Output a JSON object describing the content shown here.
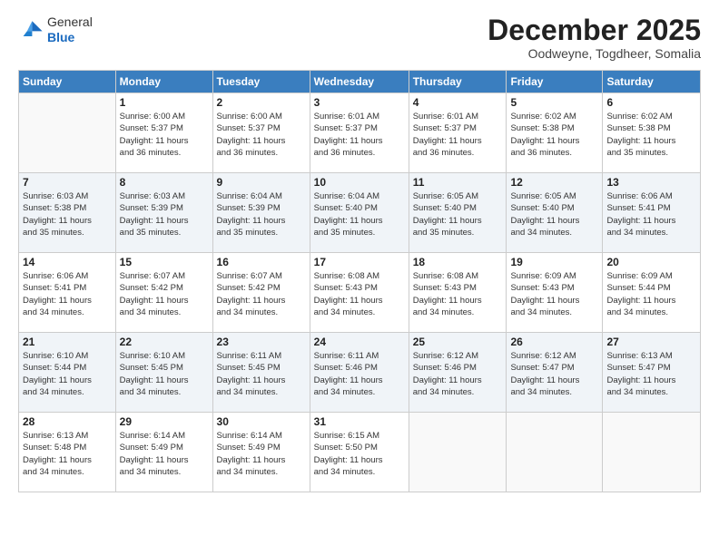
{
  "header": {
    "logo_line1": "General",
    "logo_line2": "Blue",
    "month": "December 2025",
    "location": "Oodweyne, Togdheer, Somalia"
  },
  "days_of_week": [
    "Sunday",
    "Monday",
    "Tuesday",
    "Wednesday",
    "Thursday",
    "Friday",
    "Saturday"
  ],
  "weeks": [
    [
      {
        "day": "",
        "info": ""
      },
      {
        "day": "1",
        "info": "Sunrise: 6:00 AM\nSunset: 5:37 PM\nDaylight: 11 hours\nand 36 minutes."
      },
      {
        "day": "2",
        "info": "Sunrise: 6:00 AM\nSunset: 5:37 PM\nDaylight: 11 hours\nand 36 minutes."
      },
      {
        "day": "3",
        "info": "Sunrise: 6:01 AM\nSunset: 5:37 PM\nDaylight: 11 hours\nand 36 minutes."
      },
      {
        "day": "4",
        "info": "Sunrise: 6:01 AM\nSunset: 5:37 PM\nDaylight: 11 hours\nand 36 minutes."
      },
      {
        "day": "5",
        "info": "Sunrise: 6:02 AM\nSunset: 5:38 PM\nDaylight: 11 hours\nand 36 minutes."
      },
      {
        "day": "6",
        "info": "Sunrise: 6:02 AM\nSunset: 5:38 PM\nDaylight: 11 hours\nand 35 minutes."
      }
    ],
    [
      {
        "day": "7",
        "info": "Sunrise: 6:03 AM\nSunset: 5:38 PM\nDaylight: 11 hours\nand 35 minutes."
      },
      {
        "day": "8",
        "info": "Sunrise: 6:03 AM\nSunset: 5:39 PM\nDaylight: 11 hours\nand 35 minutes."
      },
      {
        "day": "9",
        "info": "Sunrise: 6:04 AM\nSunset: 5:39 PM\nDaylight: 11 hours\nand 35 minutes."
      },
      {
        "day": "10",
        "info": "Sunrise: 6:04 AM\nSunset: 5:40 PM\nDaylight: 11 hours\nand 35 minutes."
      },
      {
        "day": "11",
        "info": "Sunrise: 6:05 AM\nSunset: 5:40 PM\nDaylight: 11 hours\nand 35 minutes."
      },
      {
        "day": "12",
        "info": "Sunrise: 6:05 AM\nSunset: 5:40 PM\nDaylight: 11 hours\nand 34 minutes."
      },
      {
        "day": "13",
        "info": "Sunrise: 6:06 AM\nSunset: 5:41 PM\nDaylight: 11 hours\nand 34 minutes."
      }
    ],
    [
      {
        "day": "14",
        "info": "Sunrise: 6:06 AM\nSunset: 5:41 PM\nDaylight: 11 hours\nand 34 minutes."
      },
      {
        "day": "15",
        "info": "Sunrise: 6:07 AM\nSunset: 5:42 PM\nDaylight: 11 hours\nand 34 minutes."
      },
      {
        "day": "16",
        "info": "Sunrise: 6:07 AM\nSunset: 5:42 PM\nDaylight: 11 hours\nand 34 minutes."
      },
      {
        "day": "17",
        "info": "Sunrise: 6:08 AM\nSunset: 5:43 PM\nDaylight: 11 hours\nand 34 minutes."
      },
      {
        "day": "18",
        "info": "Sunrise: 6:08 AM\nSunset: 5:43 PM\nDaylight: 11 hours\nand 34 minutes."
      },
      {
        "day": "19",
        "info": "Sunrise: 6:09 AM\nSunset: 5:43 PM\nDaylight: 11 hours\nand 34 minutes."
      },
      {
        "day": "20",
        "info": "Sunrise: 6:09 AM\nSunset: 5:44 PM\nDaylight: 11 hours\nand 34 minutes."
      }
    ],
    [
      {
        "day": "21",
        "info": "Sunrise: 6:10 AM\nSunset: 5:44 PM\nDaylight: 11 hours\nand 34 minutes."
      },
      {
        "day": "22",
        "info": "Sunrise: 6:10 AM\nSunset: 5:45 PM\nDaylight: 11 hours\nand 34 minutes."
      },
      {
        "day": "23",
        "info": "Sunrise: 6:11 AM\nSunset: 5:45 PM\nDaylight: 11 hours\nand 34 minutes."
      },
      {
        "day": "24",
        "info": "Sunrise: 6:11 AM\nSunset: 5:46 PM\nDaylight: 11 hours\nand 34 minutes."
      },
      {
        "day": "25",
        "info": "Sunrise: 6:12 AM\nSunset: 5:46 PM\nDaylight: 11 hours\nand 34 minutes."
      },
      {
        "day": "26",
        "info": "Sunrise: 6:12 AM\nSunset: 5:47 PM\nDaylight: 11 hours\nand 34 minutes."
      },
      {
        "day": "27",
        "info": "Sunrise: 6:13 AM\nSunset: 5:47 PM\nDaylight: 11 hours\nand 34 minutes."
      }
    ],
    [
      {
        "day": "28",
        "info": "Sunrise: 6:13 AM\nSunset: 5:48 PM\nDaylight: 11 hours\nand 34 minutes."
      },
      {
        "day": "29",
        "info": "Sunrise: 6:14 AM\nSunset: 5:49 PM\nDaylight: 11 hours\nand 34 minutes."
      },
      {
        "day": "30",
        "info": "Sunrise: 6:14 AM\nSunset: 5:49 PM\nDaylight: 11 hours\nand 34 minutes."
      },
      {
        "day": "31",
        "info": "Sunrise: 6:15 AM\nSunset: 5:50 PM\nDaylight: 11 hours\nand 34 minutes."
      },
      {
        "day": "",
        "info": ""
      },
      {
        "day": "",
        "info": ""
      },
      {
        "day": "",
        "info": ""
      }
    ]
  ]
}
